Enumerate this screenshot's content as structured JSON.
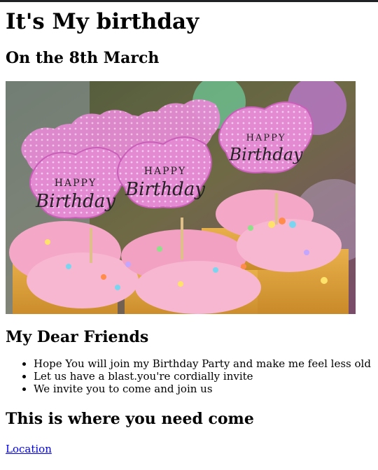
{
  "page": {
    "title": "It's My birthday",
    "date_heading": "On the 8th March",
    "image_alt": "Birthday cupcakes with Happy Birthday toppers",
    "topper_text_line1": "HAPPY",
    "topper_text_line2": "Birthday",
    "friends_heading": "My Dear Friends",
    "list_items": [
      "Hope You will join my Birthday Party and make me feel less old",
      "Let us have a blast.you're cordially invite",
      "We invite you to come and join us"
    ],
    "where_heading": "This is where you need come",
    "location_link": "Location"
  },
  "colors": {
    "link": "#0000ee",
    "frosting": "#f4a7c6",
    "topper": "#e37fcf"
  }
}
